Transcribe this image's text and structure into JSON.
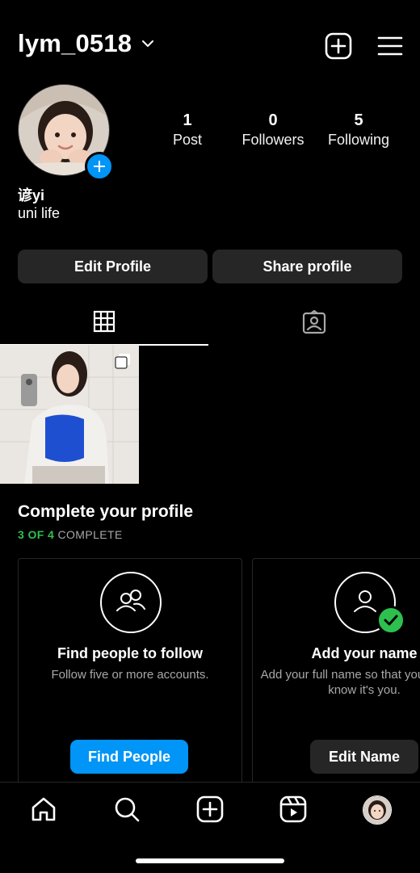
{
  "header": {
    "username": "lym_0518",
    "icons": [
      "chevron-down-icon",
      "new-post-icon",
      "menu-icon"
    ]
  },
  "profile": {
    "display_name": "谚yi",
    "bio": "uni life",
    "stats": {
      "posts": {
        "value": "1",
        "label": "Post"
      },
      "followers": {
        "value": "0",
        "label": "Followers"
      },
      "following": {
        "value": "5",
        "label": "Following"
      }
    },
    "buttons": {
      "edit": "Edit Profile",
      "share": "Share profile"
    }
  },
  "tabs": [
    {
      "name": "grid",
      "icon": "grid-icon",
      "active": true
    },
    {
      "name": "tagged",
      "icon": "tagged-icon",
      "active": false
    }
  ],
  "complete_profile": {
    "title": "Complete your profile",
    "progress_count": "3 OF 4",
    "progress_suffix": " COMPLETE",
    "cards": [
      {
        "title": "Find people to follow",
        "description": "Follow five or more accounts.",
        "button": "Find People",
        "icon": "people-icon"
      },
      {
        "title": "Add your name",
        "description": "Add your full name so that your friends know it's you.",
        "button": "Edit Name",
        "icon": "user-icon",
        "completed": true
      }
    ]
  },
  "bottom_nav": [
    "home-icon",
    "search-icon",
    "create-icon",
    "reels-icon",
    "profile-avatar"
  ],
  "colors": {
    "accent": "#0095f6",
    "success": "#2ec04f",
    "button_bg": "#262626",
    "muted_text": "#a8a8a8"
  }
}
